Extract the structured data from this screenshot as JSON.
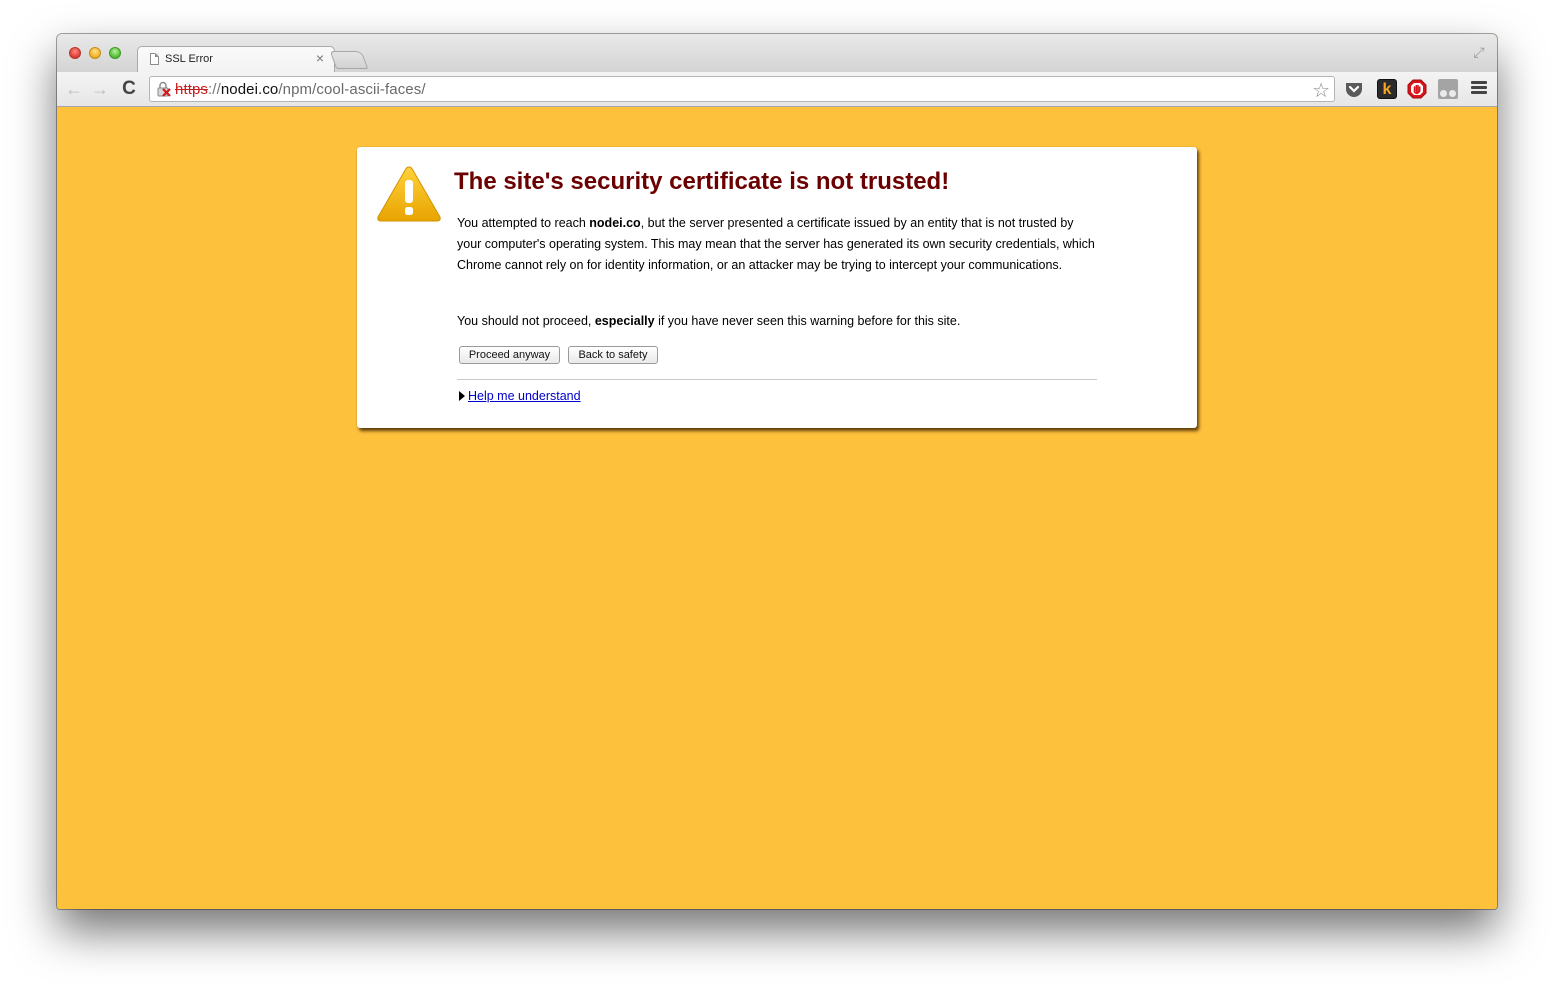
{
  "window": {
    "tab": {
      "title": "SSL Error",
      "close_glyph": "×"
    },
    "fullscreen_glyph": "⤢"
  },
  "toolbar": {
    "back_glyph": "←",
    "forward_glyph": "→",
    "reload_glyph": "C",
    "url": {
      "scheme": "https",
      "separator": "://",
      "host": "nodei.co",
      "path": "/npm/cool-ascii-faces/"
    },
    "star_glyph": "☆",
    "extensions": [
      {
        "name": "pocket-icon"
      },
      {
        "name": "k-extension-icon",
        "label": "k"
      },
      {
        "name": "adblock-icon"
      },
      {
        "name": "ghostery-icon"
      }
    ]
  },
  "interstitial": {
    "headline": "The site's security certificate is not trusted!",
    "p1": {
      "pre": "You attempted to reach ",
      "host": "nodei.co",
      "post": ", but the server presented a certificate issued by an entity that is not trusted by your computer's operating system. This may mean that the server has generated its own security credentials, which Chrome cannot rely on for identity information, or an attacker may be trying to intercept your communications."
    },
    "p2": {
      "pre": "You should not proceed, ",
      "emph": "especially",
      "post": " if you have never seen this warning before for this site."
    },
    "proceed_label": "Proceed anyway",
    "back_label": "Back to safety",
    "help_label": "Help me understand"
  },
  "colors": {
    "page_background": "#fec13b",
    "headline": "#6b0000",
    "link": "#0000cc",
    "url_error": "#c81e1e"
  }
}
